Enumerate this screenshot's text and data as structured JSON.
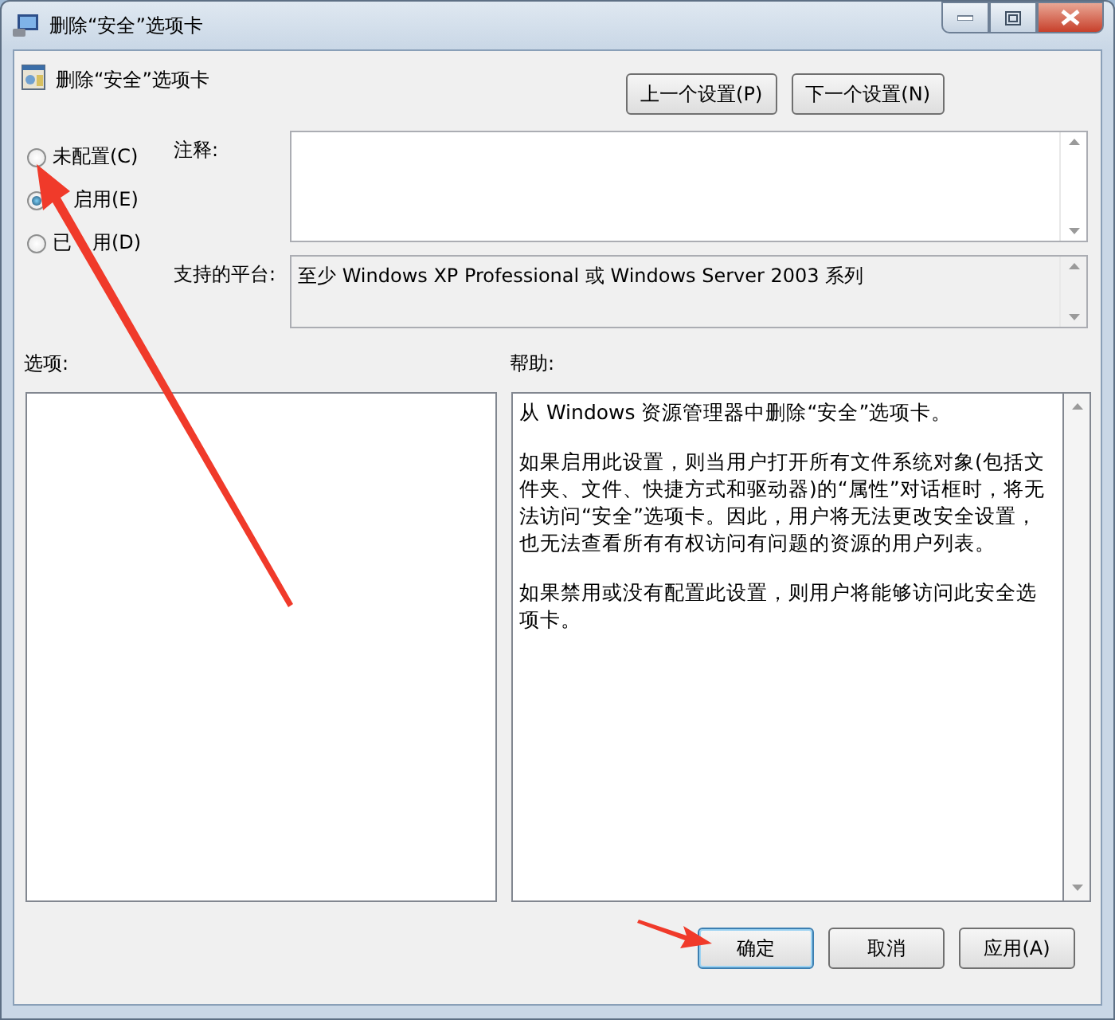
{
  "window": {
    "title": "删除“安全”选项卡"
  },
  "header": {
    "title": "删除“安全”选项卡",
    "buttons": [
      "上一个设置(P)",
      "下一个设置(N)"
    ]
  },
  "states": [
    {
      "label_parts": [
        "未配置(C)"
      ],
      "selected": false
    },
    {
      "label_parts": [
        "启用(E)"
      ],
      "covered_start": true,
      "selected": true
    },
    {
      "label_parts": [
        "已",
        "用(D)"
      ],
      "selected": false
    }
  ],
  "comment": {
    "label": "注释:"
  },
  "platform": {
    "label": "支持的平台:",
    "value": "至少 Windows XP Professional 或 Windows Server 2003 系列"
  },
  "options": {
    "label": "选项:"
  },
  "help": {
    "label": "帮助:",
    "paragraphs": [
      "从 Windows 资源管理器中删除“安全”选项卡。",
      "如果启用此设置，则当用户打开所有文件系统对象(包括文件夹、文件、快捷方式和驱动器)的“属性”对话框时，将无法访问“安全”选项卡。因此，用户将无法更改安全设置，也无法查看所有有权访问有问题的资源的用户列表。",
      "如果禁用或没有配置此设置，则用户将能够访问此安全选项卡。"
    ]
  },
  "buttons": [
    {
      "label": "确定",
      "selected": true
    },
    {
      "label": "取消",
      "selected": false
    },
    {
      "label": "应用(A)",
      "selected": false
    }
  ]
}
